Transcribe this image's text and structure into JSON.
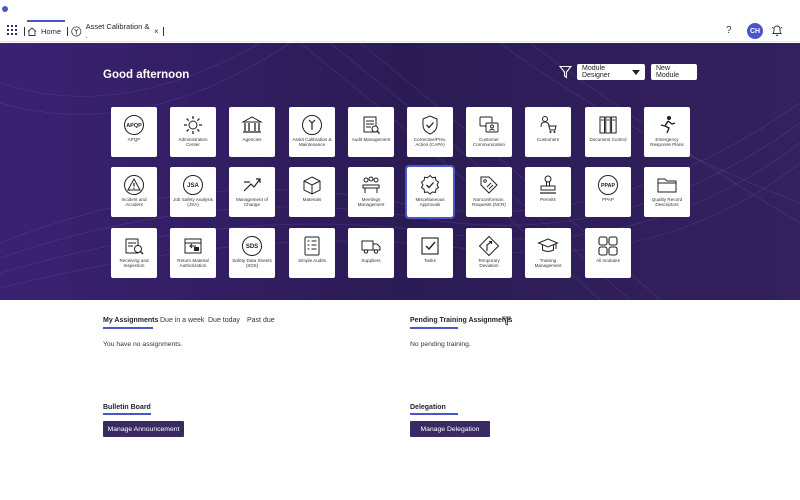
{
  "topbar": {
    "tabs": [
      {
        "label": "Home",
        "icon": "home-icon"
      },
      {
        "label": "Asset Calibration & .",
        "icon": "asset-icon"
      }
    ],
    "close_glyph": "×",
    "help_glyph": "?",
    "avatar_initials": "CH"
  },
  "hero": {
    "greeting": "Good afternoon",
    "module_designer_label": "Module Designer",
    "new_module_label": "New Module"
  },
  "modules": [
    {
      "label": "APQP",
      "icon": "apqp-icon"
    },
    {
      "label": "Administration Center",
      "icon": "admin-gear-icon"
    },
    {
      "label": "Agencies",
      "icon": "agency-building-icon"
    },
    {
      "label": "Asset Calibration & Maintenance",
      "icon": "wrench-icon"
    },
    {
      "label": "Audit Management",
      "icon": "audit-doc-icon"
    },
    {
      "label": "Corrective/Prev. Action (CAPA)",
      "icon": "shield-check-icon"
    },
    {
      "label": "Customer Communication",
      "icon": "customer-chat-icon"
    },
    {
      "label": "Customers",
      "icon": "customer-cart-icon"
    },
    {
      "label": "Document Control",
      "icon": "binders-icon"
    },
    {
      "label": "Emergency Response Plans",
      "icon": "emergency-exit-icon"
    },
    {
      "label": "Incident and Accident",
      "icon": "warning-icon"
    },
    {
      "label": "Job Safety Analysis (JSA)",
      "icon": "jsa-icon"
    },
    {
      "label": "Management of Change",
      "icon": "change-arrows-icon"
    },
    {
      "label": "Materials",
      "icon": "box-icon"
    },
    {
      "label": "Meetings Management",
      "icon": "meeting-icon"
    },
    {
      "label": "Miscellaneous Approvals",
      "icon": "approval-badge-icon"
    },
    {
      "label": "Nonconforman. Requests (NCR)",
      "icon": "tag-icon"
    },
    {
      "label": "Permits",
      "icon": "permit-stamp-icon"
    },
    {
      "label": "PPAP",
      "icon": "ppap-icon"
    },
    {
      "label": "Quality Record Descriptors",
      "icon": "folder-icon"
    },
    {
      "label": "Receiving and Inspection",
      "icon": "inspection-icon"
    },
    {
      "label": "Return Material Authorization",
      "icon": "return-box-icon"
    },
    {
      "label": "Safety Data Sheets (SDS)",
      "icon": "sds-icon"
    },
    {
      "label": "Simple Audits",
      "icon": "checklist-icon"
    },
    {
      "label": "Suppliers",
      "icon": "truck-icon"
    },
    {
      "label": "Tasks",
      "icon": "task-check-icon"
    },
    {
      "label": "Temporary Deviation",
      "icon": "road-sign-icon"
    },
    {
      "label": "Training Management",
      "icon": "graduation-cap-icon"
    },
    {
      "label": "All modules",
      "icon": "grid-squares-icon"
    }
  ],
  "assignments": {
    "title": "My Assignments",
    "tabs": [
      "Due in a week",
      "Due today",
      "Past due"
    ],
    "empty_text": "You have no assignments."
  },
  "training": {
    "title": "Pending Training Assignments",
    "empty_text": "No pending training."
  },
  "bulletin": {
    "title": "Bulletin Board",
    "button_label": "Manage Announcement"
  },
  "delegation": {
    "title": "Delegation",
    "button_label": "Manage Delegation"
  },
  "colors": {
    "accent": "#4a55c9",
    "hero_bg": "#2b1b55",
    "dark_button": "#3a2a63"
  }
}
